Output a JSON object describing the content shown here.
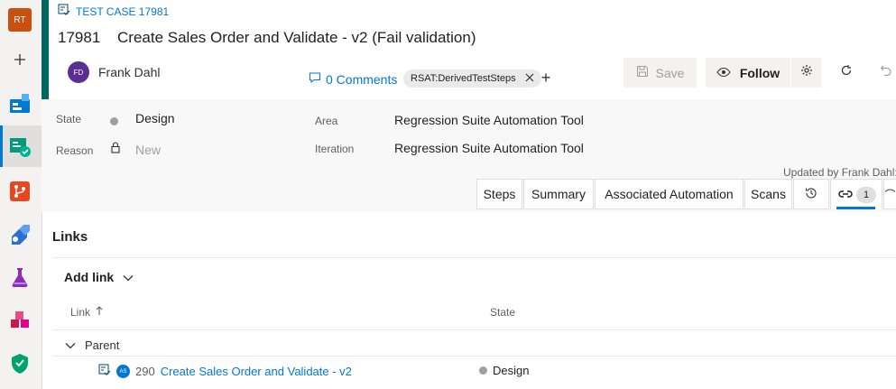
{
  "rail": {
    "avatar_initials": "RT",
    "items": [
      {
        "name": "add-icon"
      },
      {
        "name": "boards-icon"
      },
      {
        "name": "test-plans-icon"
      },
      {
        "name": "repos-icon"
      },
      {
        "name": "pipelines-icon"
      },
      {
        "name": "test-icon"
      },
      {
        "name": "artifacts-icon"
      },
      {
        "name": "security-icon"
      }
    ]
  },
  "work_item": {
    "type_label": "TEST CASE 17981",
    "id": "17981",
    "title": "Create Sales Order and Validate - v2 (Fail validation)",
    "assignee": "Frank Dahl",
    "assignee_initials": "FD",
    "comments_label": "0 Comments",
    "tag": "RSAT:DerivedTestSteps"
  },
  "toolbar": {
    "save_label": "Save",
    "follow_label": "Follow"
  },
  "fields": {
    "state_label": "State",
    "state_value": "Design",
    "reason_label": "Reason",
    "reason_value": "New",
    "area_label": "Area",
    "area_value": "Regression Suite Automation Tool",
    "iteration_label": "Iteration",
    "iteration_value": "Regression Suite Automation Tool",
    "updated_by": "Updated by Frank Dahl:"
  },
  "tabs": {
    "steps": "Steps",
    "summary": "Summary",
    "associated_automation": "Associated Automation",
    "scans": "Scans",
    "links_count": "1"
  },
  "links": {
    "title": "Links",
    "add_link_label": "Add link",
    "columns": {
      "link": "Link",
      "state": "State"
    },
    "group_label": "Parent",
    "rows": [
      {
        "id": "290",
        "name": "Create Sales Order and Validate - v2",
        "state": "Design",
        "avatar": "AS"
      }
    ]
  },
  "colors": {
    "accent": "#0078d4",
    "work_item_bar": "#00665f",
    "state_dot": "#a19f9d"
  }
}
